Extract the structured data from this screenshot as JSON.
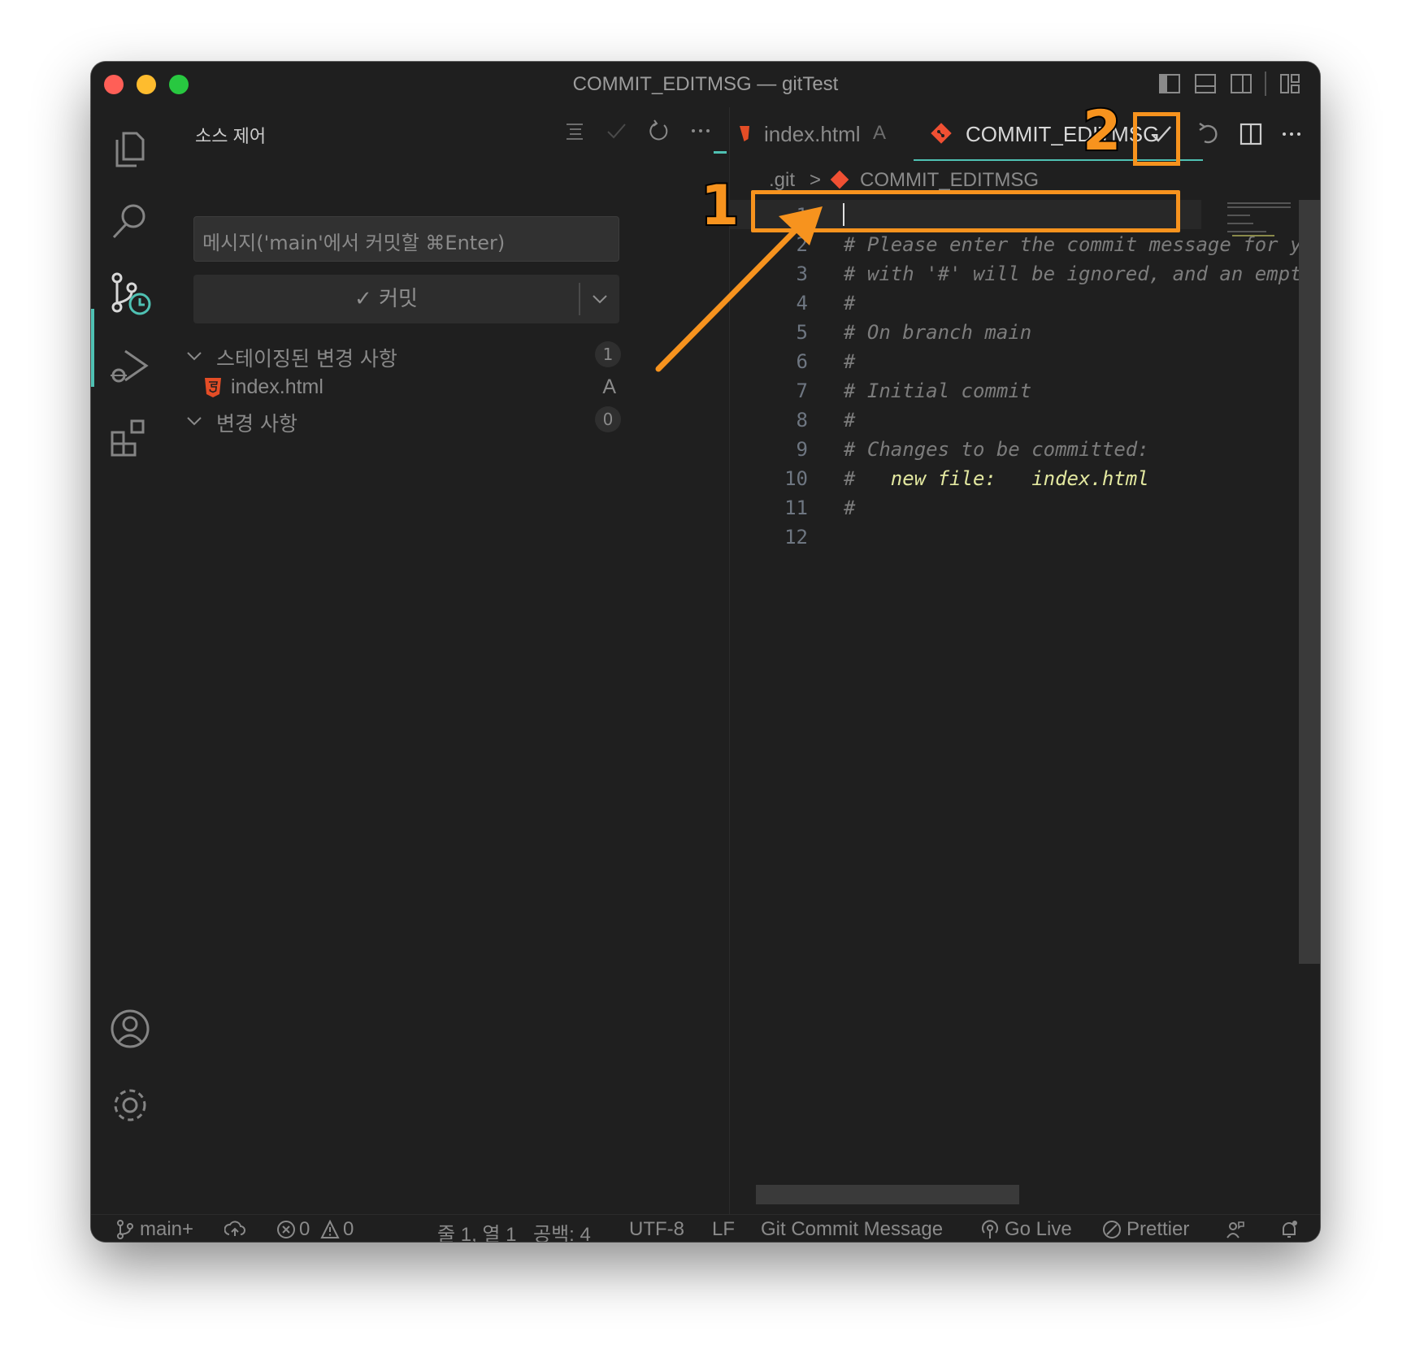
{
  "window": {
    "title": "COMMIT_EDITMSG — gitTest"
  },
  "activity_bar": {
    "items": [
      "explorer-icon",
      "search-icon",
      "source-control-icon",
      "run-debug-icon",
      "extensions-icon",
      "account-icon",
      "settings-gear-icon"
    ],
    "active": "source-control-icon"
  },
  "sidebar": {
    "title": "소스 제어",
    "message_placeholder": "메시지('main'에서 커밋할 ⌘Enter)",
    "commit_button": "✓ 커밋",
    "staged": {
      "label": "스테이징된 변경 사항",
      "count": "1"
    },
    "staged_files": [
      {
        "name": "index.html",
        "status": "A"
      }
    ],
    "changes": {
      "label": "변경 사항",
      "count": "0"
    }
  },
  "tabs": [
    {
      "label": "index.html",
      "status": "A",
      "active": false
    },
    {
      "label": "COMMIT_EDITMSG",
      "active": true
    }
  ],
  "breadcrumb": {
    "folder": ".git",
    "separator": ">",
    "file": "COMMIT_EDITMSG"
  },
  "editor": {
    "lines": [
      {
        "n": "1",
        "text": ""
      },
      {
        "n": "2",
        "text": "# Please enter the commit message for yo"
      },
      {
        "n": "3",
        "text": "# with '#' will be ignored, and an empty"
      },
      {
        "n": "4",
        "text": "#"
      },
      {
        "n": "5",
        "text": "# On branch main"
      },
      {
        "n": "6",
        "text": "#"
      },
      {
        "n": "7",
        "text": "# Initial commit"
      },
      {
        "n": "8",
        "text": "#"
      },
      {
        "n": "9",
        "text": "# Changes to be committed:"
      },
      {
        "n": "10",
        "text_prefix": "#   ",
        "text_kw": "new file:   index.html"
      },
      {
        "n": "11",
        "text": "#"
      },
      {
        "n": "12",
        "text": ""
      }
    ]
  },
  "status_bar": {
    "branch": "main+",
    "errors": "0",
    "warnings": "0",
    "position": "줄 1, 열 1",
    "spaces": "공백: 4",
    "encoding": "UTF-8",
    "eol": "LF",
    "language": "Git Commit Message",
    "go_live": "Go Live",
    "prettier": "Prettier"
  },
  "annotations": {
    "step1": "1",
    "step2": "2",
    "color": "#f7931e"
  },
  "colors": {
    "accent": "#4fc1b3",
    "background": "#1f1f1f",
    "git_orange": "#f05033",
    "html_orange": "#e44d26",
    "keyword": "#e3e8a0"
  }
}
